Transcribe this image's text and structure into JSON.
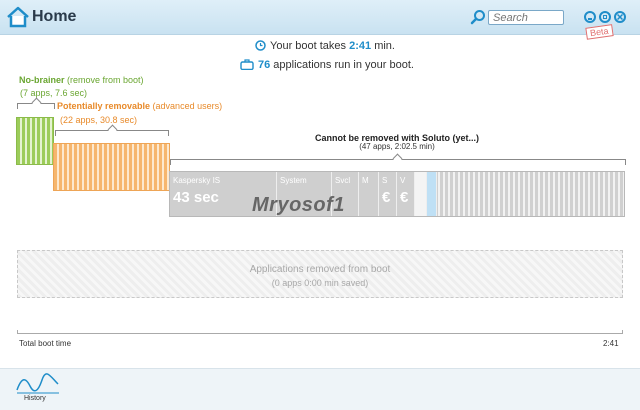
{
  "window": {
    "title": "Home",
    "badge": "Beta"
  },
  "search": {
    "placeholder": "Search"
  },
  "summary": {
    "boot_prefix": "Your boot takes ",
    "boot_time": "2:41",
    "boot_suffix": " min.",
    "apps_count": "76",
    "apps_suffix": " applications run in your boot."
  },
  "no_brainer": {
    "title": "No-brainer",
    "subtitle": " (remove from boot)",
    "stats": "(7 apps, 7.6 sec)"
  },
  "removable": {
    "title": "Potentially removable",
    "subtitle": " (advanced users)",
    "stats": "(22 apps, 30.8 sec)"
  },
  "cannot": {
    "title": "Cannot be removed with Soluto (yet...)",
    "stats": "(47 apps, 2:02.5 min)"
  },
  "segments": [
    {
      "name": "Kaspersky IS",
      "value": "43 sec"
    },
    {
      "name": "System",
      "value": ""
    },
    {
      "name": "Svcl",
      "value": ""
    },
    {
      "name": "M",
      "value": ""
    },
    {
      "name": "S",
      "value": "€"
    },
    {
      "name": "V",
      "value": "€"
    }
  ],
  "removed": {
    "title": "Applications removed from boot",
    "stats": "(0 apps 0:00 min saved)"
  },
  "timeline": {
    "start_label": "Total boot time",
    "end_label": "2:41"
  },
  "nav": {
    "history_label": "History"
  },
  "watermark": "Mryosof1"
}
